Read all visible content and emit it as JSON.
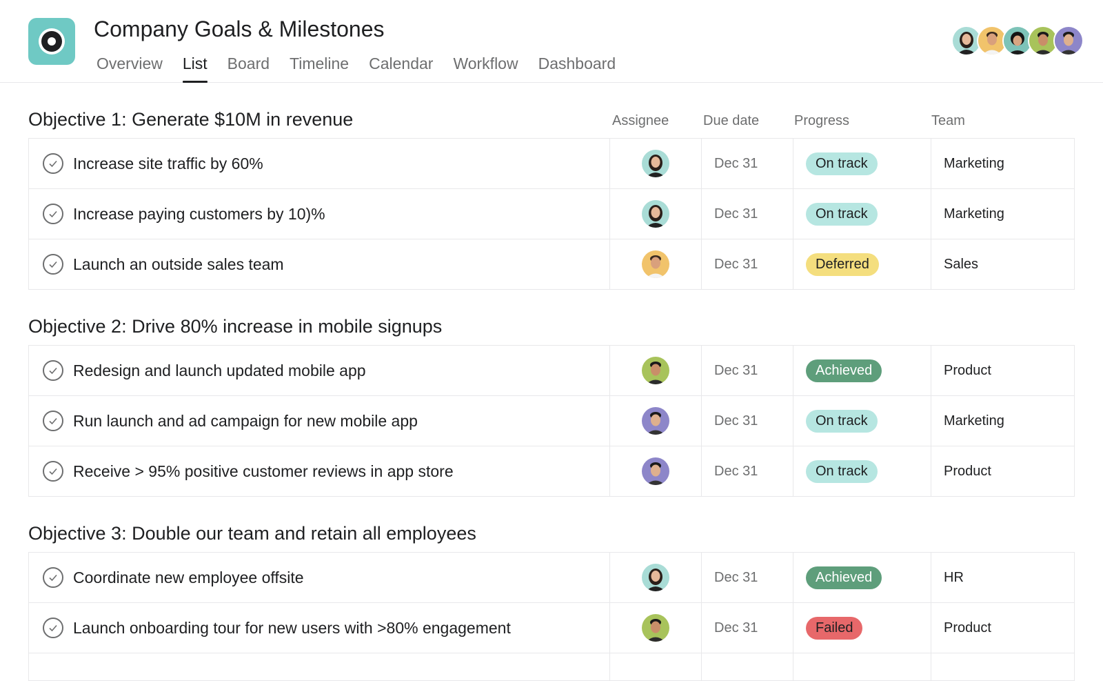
{
  "header": {
    "title": "Company Goals & Milestones",
    "tabs": [
      {
        "label": "Overview"
      },
      {
        "label": "List"
      },
      {
        "label": "Board"
      },
      {
        "label": "Timeline"
      },
      {
        "label": "Calendar"
      },
      {
        "label": "Workflow"
      },
      {
        "label": "Dashboard"
      }
    ],
    "active_tab": "List"
  },
  "columns": {
    "assignee": "Assignee",
    "due_date": "Due date",
    "progress": "Progress",
    "team": "Team"
  },
  "colors": {
    "on_track_bg": "#b6e6e1",
    "deferred_bg": "#f4de7e",
    "achieved_bg": "#5e9e7b",
    "failed_bg": "#e7686a",
    "logo_bg": "#6fc9c4"
  },
  "objectives": [
    {
      "title": "Objective 1: Generate $10M in revenue",
      "tasks": [
        {
          "name": "Increase site traffic by 60%",
          "due": "Dec 31",
          "status": "On track",
          "team": "Marketing"
        },
        {
          "name": "Increase paying customers by 10)%",
          "due": "Dec 31",
          "status": "On track",
          "team": "Marketing"
        },
        {
          "name": "Launch an outside sales team",
          "due": "Dec 31",
          "status": "Deferred",
          "team": "Sales"
        }
      ]
    },
    {
      "title": "Objective 2: Drive 80% increase in mobile signups",
      "tasks": [
        {
          "name": "Redesign and launch updated mobile app",
          "due": "Dec 31",
          "status": "Achieved",
          "team": "Product"
        },
        {
          "name": "Run launch and ad campaign for new mobile app",
          "due": "Dec 31",
          "status": "On track",
          "team": "Marketing"
        },
        {
          "name": "Receive > 95% positive customer reviews in app store",
          "due": "Dec 31",
          "status": "On track",
          "team": "Product"
        }
      ]
    },
    {
      "title": "Objective 3: Double our team and retain all employees",
      "tasks": [
        {
          "name": "Coordinate new employee offsite",
          "due": "Dec 31",
          "status": "Achieved",
          "team": "HR"
        },
        {
          "name": "Launch onboarding tour for new users with >80% engagement",
          "due": "Dec 31",
          "status": "Failed",
          "team": "Product"
        }
      ]
    }
  ]
}
